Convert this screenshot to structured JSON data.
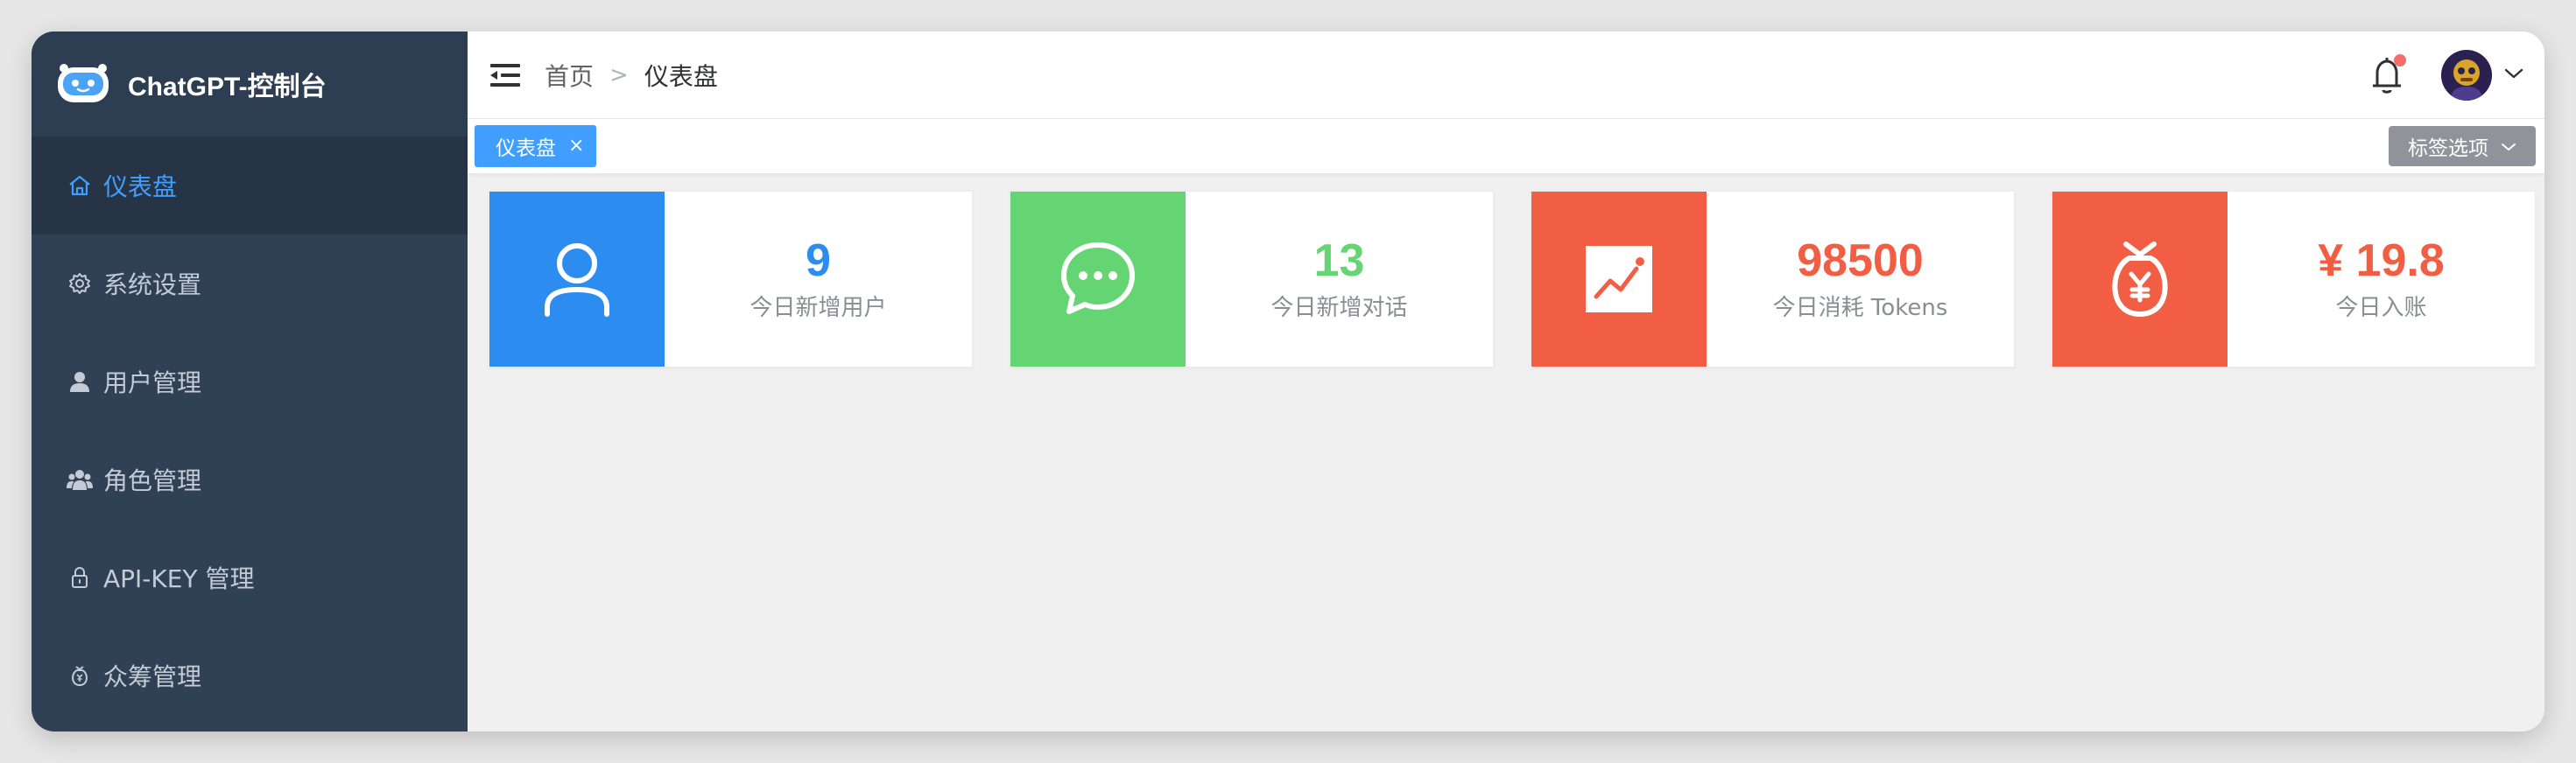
{
  "brand": {
    "title": "ChatGPT-控制台",
    "logo_icon": "robot-logo-icon"
  },
  "sidebar": {
    "items": [
      {
        "label": "仪表盘",
        "icon": "home-icon",
        "active": true
      },
      {
        "label": "系统设置",
        "icon": "gear-icon",
        "active": false
      },
      {
        "label": "用户管理",
        "icon": "user-icon",
        "active": false
      },
      {
        "label": "角色管理",
        "icon": "role-group-icon",
        "active": false
      },
      {
        "label": "API-KEY 管理",
        "icon": "lock-icon",
        "active": false
      },
      {
        "label": "众筹管理",
        "icon": "money-bag-icon",
        "active": false
      }
    ]
  },
  "header": {
    "breadcrumb": [
      "首页",
      "仪表盘"
    ],
    "breadcrumb_separator": ">",
    "notification_badge": true
  },
  "tags": {
    "items": [
      {
        "label": "仪表盘",
        "close": "×"
      }
    ],
    "options_label": "标签选项"
  },
  "cards": [
    {
      "value": "9",
      "label": "今日新增用户",
      "color": "#2d8cf0",
      "icon": "user-icon"
    },
    {
      "value": "13",
      "label": "今日新增对话",
      "color": "#64d572",
      "icon": "chat-bubble-icon"
    },
    {
      "value": "98500",
      "label": "今日消耗 Tokens",
      "color": "#f25e43",
      "icon": "chart-trend-icon"
    },
    {
      "value": "¥ 19.8",
      "label": "今日入账",
      "color": "#f25e43",
      "icon": "money-bag-icon"
    }
  ],
  "colors": {
    "sidebar_bg": "#304156",
    "active_menu_text": "#409eff",
    "tag_active_bg": "#409eff",
    "badge": "#f56c6c"
  }
}
